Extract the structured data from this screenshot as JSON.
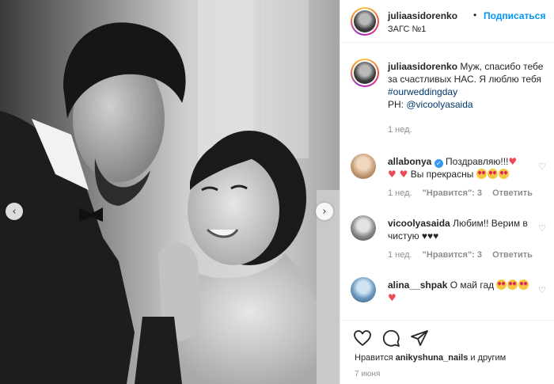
{
  "post": {
    "nav_prev_glyph": "‹",
    "nav_next_glyph": "›"
  },
  "header": {
    "username": "juliaasidorenko",
    "dot": "•",
    "follow_label": "Подписаться",
    "location": "ЗАГС №1"
  },
  "caption": {
    "username": "juliaasidorenko",
    "text": "Муж, спасибо тебе за счастливых НАС. Я люблю тебя",
    "hashtag": "#ourweddingday",
    "credit_prefix": "PH: ",
    "credit_user": "@vicoolyasaida",
    "time": "1 нед."
  },
  "comments": [
    {
      "username": "allabonya",
      "verified": true,
      "text_start": "Поздравляю!!!",
      "text_mid": "Вы прекрасны",
      "time": "1 нед.",
      "likes": "\"Нравится\": 3",
      "reply": "Ответить"
    },
    {
      "username": "vicoolyasaida",
      "text": "Любим!! Верим в чистую ♥♥♥",
      "time": "1 нед.",
      "likes": "\"Нравится\": 3",
      "reply": "Ответить"
    },
    {
      "username": "alina__shpak",
      "text": "О май гад"
    }
  ],
  "actions": {
    "likes_prefix": "Нравится ",
    "likes_user": "anikyshuna_nails",
    "likes_suffix": " и другим",
    "date": "7 июня"
  },
  "icons": [
    "chevron-left-icon",
    "chevron-right-icon",
    "heart-icon",
    "comment-icon",
    "share-icon",
    "verified-icon"
  ],
  "colors": {
    "accent": "#0095f6",
    "link": "#00376b",
    "heart": "#ed4956",
    "muted": "#8e8e8e"
  }
}
